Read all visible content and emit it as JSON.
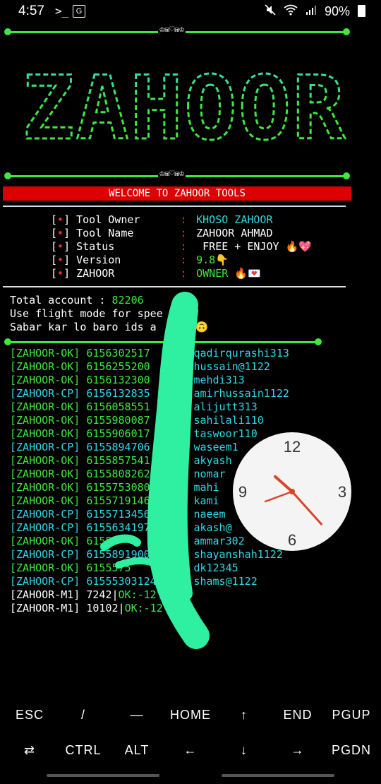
{
  "status_bar": {
    "time": "4:57",
    "terminal_icon": ">_",
    "app_icon": "G",
    "battery": "90%",
    "mute_icon": "🔕",
    "wifi_icon": "wifi",
    "signal_icon": "signal"
  },
  "divider_center": "♔⩎♡⩎♔",
  "banner_text": "ZAHOOR",
  "welcome": "WELCOME TO ZAHOOR TOOLS",
  "info": [
    {
      "label": "Tool Owner",
      "value": "KHOSO ZAHOOR",
      "color": "cyan"
    },
    {
      "label": "Tool Name",
      "value": "ZAHOOR AHMAD",
      "color": "white"
    },
    {
      "label": "Status",
      "value": " FREE + ENJOY 🔥💖",
      "color": "white"
    },
    {
      "label": "Version",
      "value": "9.8👇",
      "color": "green"
    },
    {
      "label": "ZAHOOR",
      "value": "OWNER 🔥💌",
      "color": "green"
    }
  ],
  "bracket_open": "[",
  "bracket_star": "•",
  "bracket_close": "]",
  "colon": ":",
  "total_label": "Total account : ",
  "total_value": "82206",
  "flight_msg": "Use flight mode for spee",
  "sabar_msg": "Sabar kar lo baro ids a",
  "sabar_tail": "a🙃",
  "results": [
    {
      "tag": "[ZAHOOR-OK]",
      "id": "6156302517",
      "user": "qadirqurashi313",
      "type": "ok"
    },
    {
      "tag": "[ZAHOOR-OK]",
      "id": "6156255200",
      "user": "hussain@1122",
      "type": "ok"
    },
    {
      "tag": "[ZAHOOR-OK]",
      "id": "6156132300",
      "user": "mehdi313",
      "type": "ok"
    },
    {
      "tag": "[ZAHOOR-CP]",
      "id": "6156132835",
      "user": "amirhussain1122",
      "type": "cp"
    },
    {
      "tag": "[ZAHOOR-OK]",
      "id": "6156058551",
      "user": "alijutt313",
      "type": "ok"
    },
    {
      "tag": "[ZAHOOR-OK]",
      "id": "6155980087",
      "user": "sahilali110",
      "type": "ok"
    },
    {
      "tag": "[ZAHOOR-OK]",
      "id": "6155906017",
      "user": "taswoor110",
      "type": "ok"
    },
    {
      "tag": "[ZAHOOR-CP]",
      "id": "6155894706",
      "user": "waseem1",
      "type": "cp"
    },
    {
      "tag": "[ZAHOOR-OK]",
      "id": "6155857541",
      "user": "akyash",
      "type": "ok"
    },
    {
      "tag": "[ZAHOOR-OK]",
      "id": "6155808262",
      "user": "nomar",
      "type": "ok"
    },
    {
      "tag": "[ZAHOOR-OK]",
      "id": "6155753080",
      "user": "mahi",
      "type": "ok"
    },
    {
      "tag": "[ZAHOOR-OK]",
      "id": "6155719146",
      "user": "kami",
      "type": "ok"
    },
    {
      "tag": "[ZAHOOR-CP]",
      "id": "6155713456",
      "user": "naeem",
      "type": "cp"
    },
    {
      "tag": "[ZAHOOR-CP]",
      "id": "6155634197",
      "user": "akash@",
      "type": "cp"
    },
    {
      "tag": "[ZAHOOR-OK]",
      "id": "6155",
      "user": "ammar302",
      "type": "ok"
    },
    {
      "tag": "[ZAHOOR-CP]",
      "id": "6155891900",
      "user": "shayanshah1122",
      "type": "cp"
    },
    {
      "tag": "[ZAHOOR-OK]",
      "id": "6155575",
      "user": "dk12345",
      "type": "ok"
    },
    {
      "tag": "[ZAHOOR-CP]",
      "id": "61555303124",
      "user": "shams@1122",
      "type": "cp"
    }
  ],
  "m1_rows": [
    {
      "tag": "[ZAHOOR-M1]",
      "count": "7242",
      "ok": "OK:-12"
    },
    {
      "tag": "[ZAHOOR-M1]",
      "count": "10102",
      "ok": "OK:-12"
    }
  ],
  "clock": {
    "n12": "12",
    "n3": "3",
    "n6": "6",
    "n9": "9",
    "hour": 10,
    "minute": 23
  },
  "keys_row1": [
    "ESC",
    "/",
    "—",
    "HOME",
    "↑",
    "END",
    "PGUP"
  ],
  "keys_row2": [
    "⇄",
    "CTRL",
    "ALT",
    "←",
    "↓",
    "→",
    "PGDN"
  ],
  "colors": {
    "green": "#3ee83e",
    "cyan": "#2fd8e6",
    "red": "#dd0000",
    "scribble": "#2ff0a0"
  }
}
